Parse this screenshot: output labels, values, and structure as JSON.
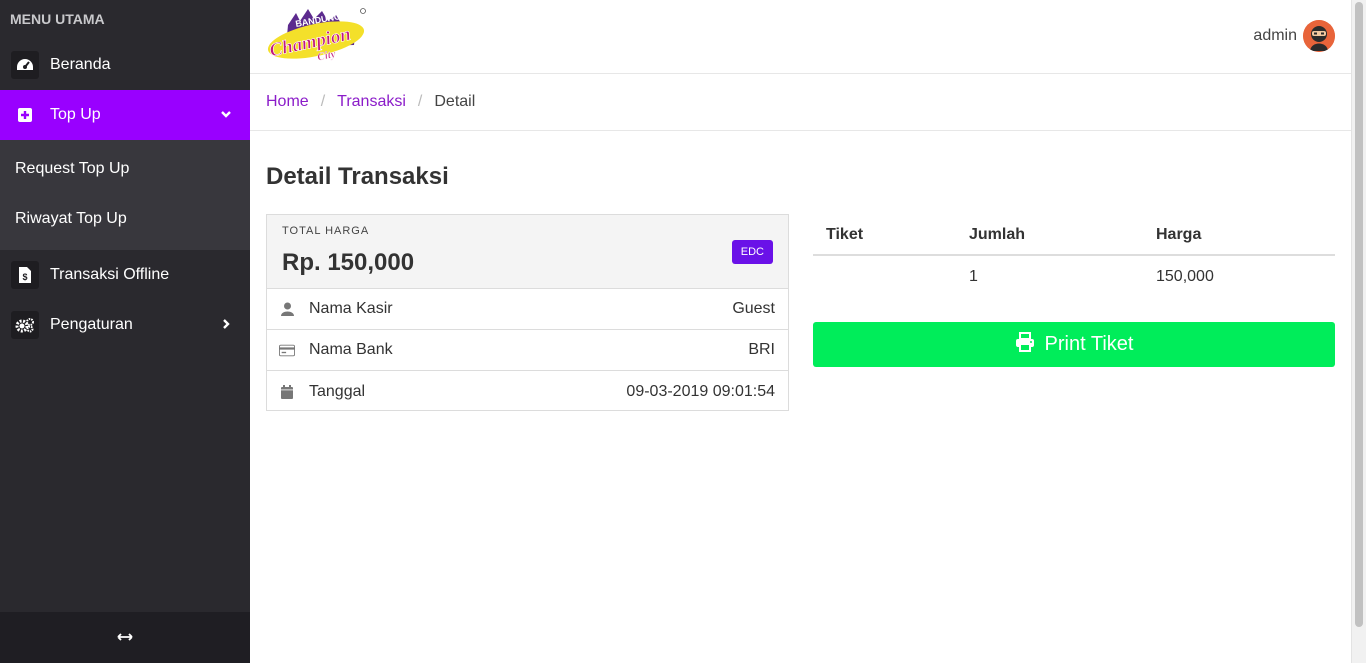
{
  "sidebar": {
    "menu_title": "MENU UTAMA",
    "items": [
      {
        "label": "Beranda",
        "icon": "dashboard-icon"
      },
      {
        "label": "Top Up",
        "icon": "plus-square-icon"
      },
      {
        "label": "Transaksi Offline",
        "icon": "file-dollar-icon"
      },
      {
        "label": "Pengaturan",
        "icon": "gears-icon"
      }
    ],
    "submenu": [
      {
        "label": "Request Top Up"
      },
      {
        "label": "Riwayat Top Up"
      }
    ],
    "footer_icon": "arrows-horizontal-icon"
  },
  "header": {
    "logo_text_top": "BANDUNG",
    "logo_text_main": "Champion",
    "logo_text_sub": "City",
    "user_name": "admin"
  },
  "breadcrumb": [
    "Home",
    "Transaksi",
    "Detail"
  ],
  "page_title": "Detail Transaksi",
  "summary": {
    "total_label": "TOTAL HARGA",
    "total_value": "Rp. 150,000",
    "badge": "EDC",
    "rows": [
      {
        "label": "Nama Kasir",
        "value": "Guest",
        "icon": "user-icon"
      },
      {
        "label": "Nama Bank",
        "value": "BRI",
        "icon": "credit-card-icon"
      },
      {
        "label": "Tanggal",
        "value": "09-03-2019 09:01:54",
        "icon": "calendar-icon"
      }
    ]
  },
  "table": {
    "headers": [
      "Tiket",
      "Jumlah",
      "Harga"
    ],
    "rows": [
      {
        "tiket": "",
        "jumlah": "1",
        "harga": "150,000"
      }
    ]
  },
  "print_button": {
    "label": "Print Tiket"
  },
  "colors": {
    "sidebar_bg": "#2a292e",
    "active_item": "#9900ff",
    "link": "#8b1cc9",
    "badge": "#6a11e8",
    "print_button": "#00ed5a"
  }
}
